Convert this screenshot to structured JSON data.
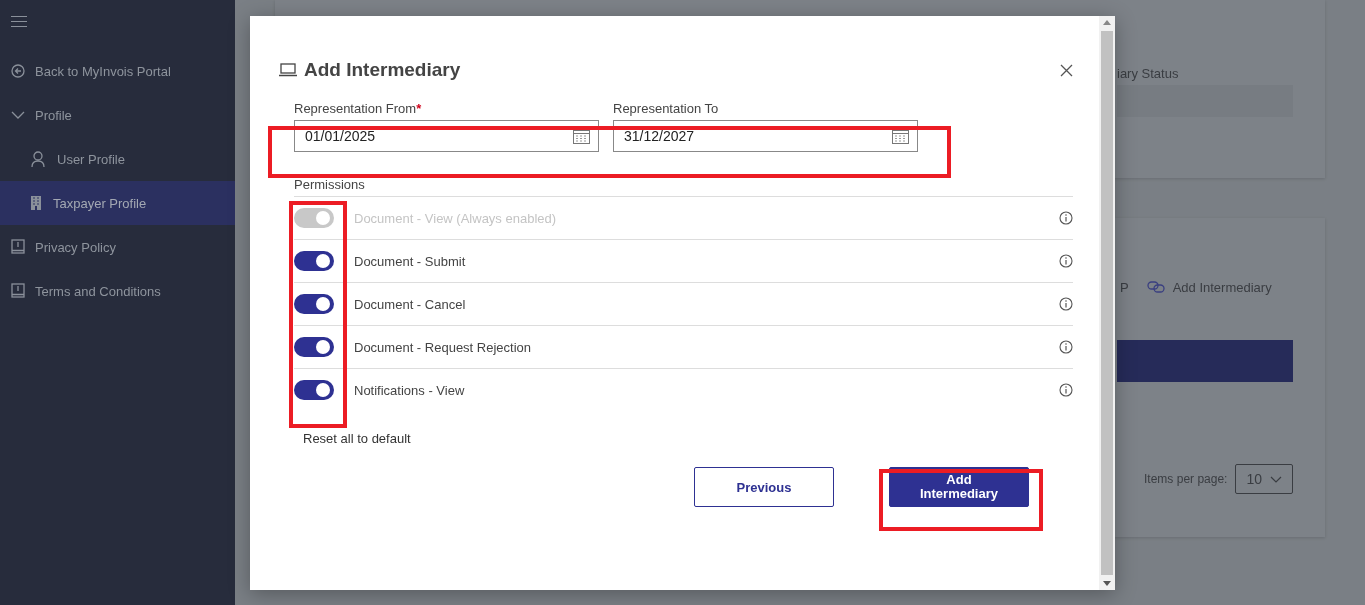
{
  "sidebar": {
    "items": [
      {
        "label": "Back to MyInvois Portal",
        "selected": false
      },
      {
        "label": "Profile",
        "selected": false,
        "expanded": true,
        "children": [
          {
            "label": "User Profile",
            "selected": false
          },
          {
            "label": "Taxpayer Profile",
            "selected": true
          }
        ]
      },
      {
        "label": "Privacy Policy",
        "selected": false
      },
      {
        "label": "Terms and Conditions",
        "selected": false
      }
    ]
  },
  "background": {
    "status_label": "iary Status",
    "tab_fragment": "P",
    "add_link": "Add Intermediary",
    "items_per_page_label": "Items per page:",
    "items_per_page": "10"
  },
  "dialog": {
    "title": "Add Intermediary",
    "fields": [
      {
        "label": "Representation From",
        "required_mark": "*",
        "value": "01/01/2025"
      },
      {
        "label": "Representation To",
        "value": "31/12/2027"
      }
    ],
    "permissions_label": "Permissions",
    "permissions": [
      {
        "label": "Document - View (Always enabled)",
        "on": true,
        "disabled": true
      },
      {
        "label": "Document - Submit",
        "on": true,
        "disabled": false
      },
      {
        "label": "Document - Cancel",
        "on": true,
        "disabled": false
      },
      {
        "label": "Document - Request Rejection",
        "on": true,
        "disabled": false
      },
      {
        "label": "Notifications - View",
        "on": true,
        "disabled": false
      }
    ],
    "reset_link": "Reset all to default",
    "buttons": [
      {
        "label": "Previous",
        "kind": "secondary"
      },
      {
        "label": "Add Intermediary",
        "kind": "primary"
      }
    ]
  }
}
